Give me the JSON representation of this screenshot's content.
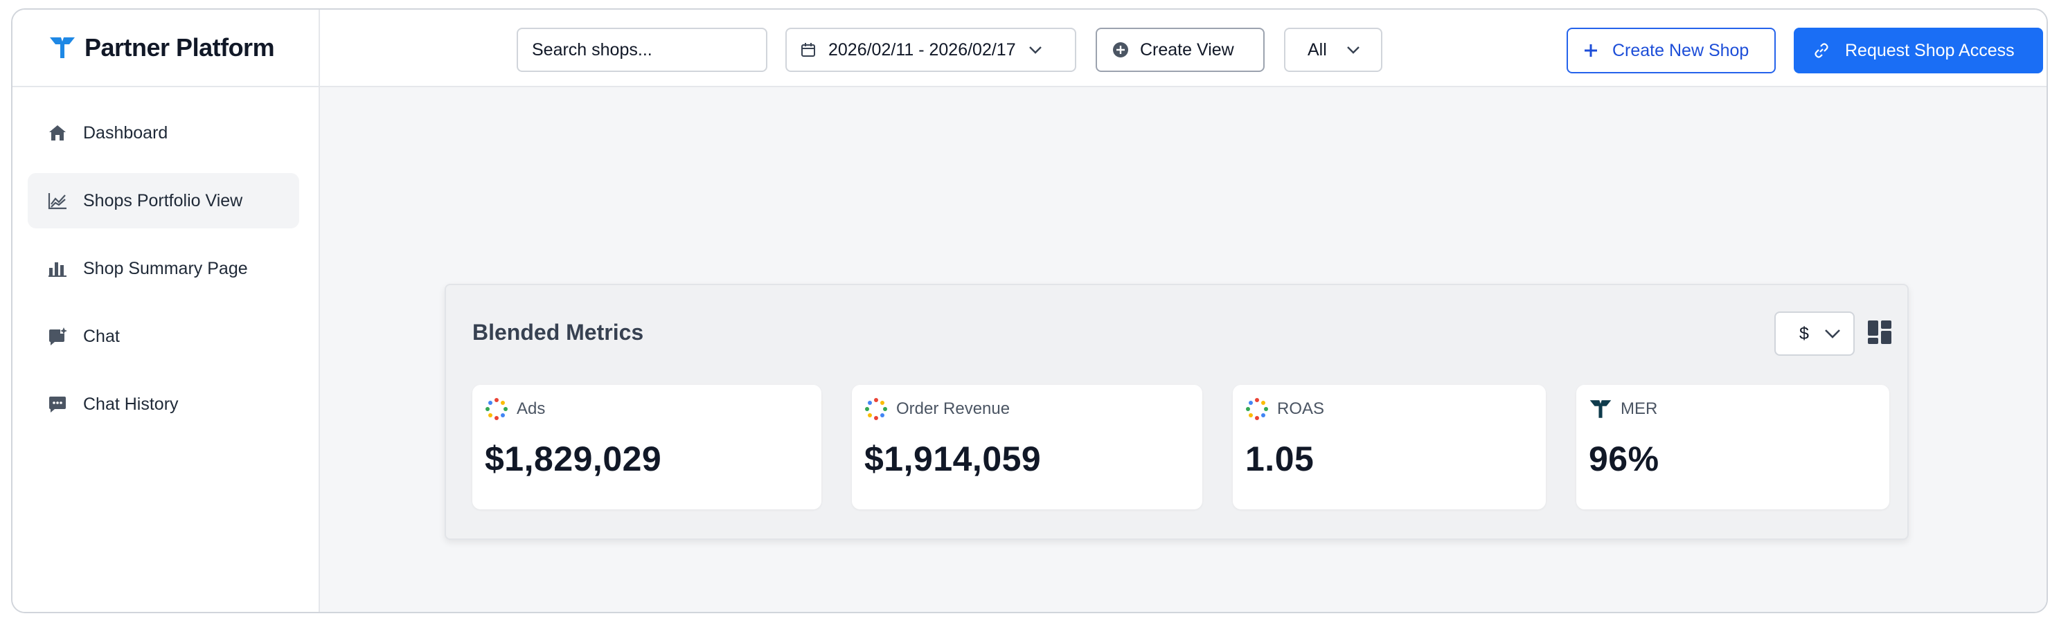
{
  "app": {
    "title": "Partner Platform"
  },
  "sidebar": {
    "items": [
      {
        "label": "Dashboard",
        "icon": "home-icon",
        "active": false
      },
      {
        "label": "Shops Portfolio View",
        "icon": "line-chart-icon",
        "active": true
      },
      {
        "label": "Shop Summary Page",
        "icon": "bar-chart-icon",
        "active": false
      },
      {
        "label": "Chat",
        "icon": "chat-sparkle-icon",
        "active": false
      },
      {
        "label": "Chat History",
        "icon": "chat-history-icon",
        "active": false
      }
    ]
  },
  "header": {
    "search_placeholder": "Search shops...",
    "date_range": "2026/02/11 - 2026/02/17",
    "create_view_label": "Create View",
    "filter_value": "All",
    "create_shop_label": "Create New Shop",
    "request_access_label": "Request Shop Access"
  },
  "panel": {
    "title": "Blended Metrics",
    "currency": "$",
    "cards": [
      {
        "label": "Ads",
        "value": "$1,829,029",
        "icon": "spinner-dots-icon"
      },
      {
        "label": "Order Revenue",
        "value": "$1,914,059",
        "icon": "spinner-dots-icon"
      },
      {
        "label": "ROAS",
        "value": "1.05",
        "icon": "spinner-dots-icon"
      },
      {
        "label": "MER",
        "value": "96%",
        "icon": "brand-logo-icon"
      }
    ]
  },
  "colors": {
    "primary": "#1a6ef5",
    "brand_logo": "#1e88e5",
    "mer_logo": "#0f3b4c",
    "main_bg": "#f5f6f8"
  }
}
